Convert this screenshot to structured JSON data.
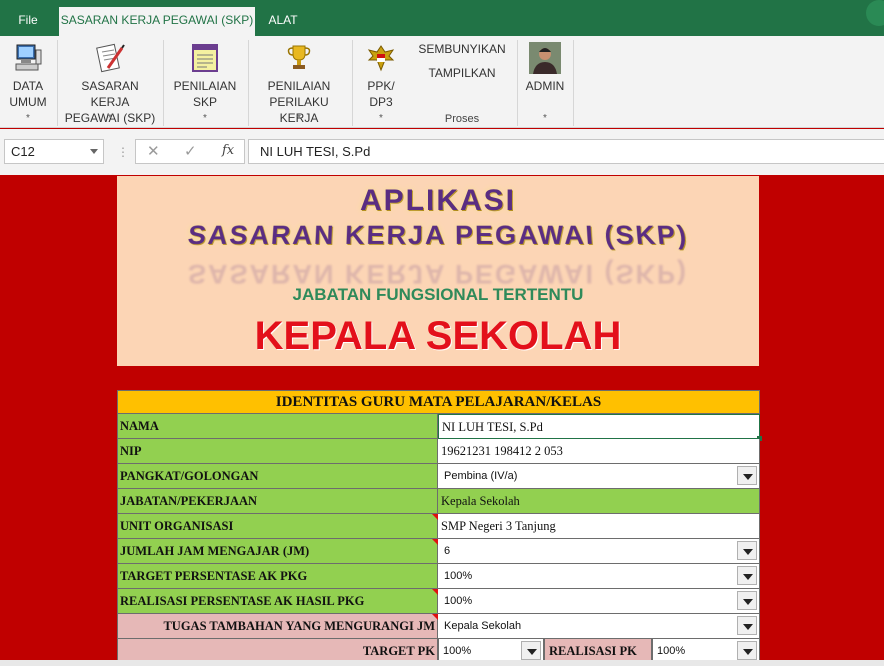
{
  "tabs": {
    "file": "File",
    "skp": "SASARAN KERJA PEGAWAI (SKP)",
    "alat": "ALAT"
  },
  "ribbon": {
    "groups": [
      {
        "label1": "DATA",
        "label2": "UMUM",
        "star": "*",
        "icon": "computer-icon"
      },
      {
        "label1": "SASARAN KERJA",
        "label2": "PEGAWAI (SKP)",
        "star": "*",
        "icon": "document-pen-icon"
      },
      {
        "label1": "PENILAIAN",
        "label2": "SKP",
        "star": "*",
        "icon": "notebook-icon"
      },
      {
        "label1": "PENILAIAN",
        "label2": "PERILAKU KERJA",
        "star": "*",
        "icon": "trophy-icon"
      },
      {
        "label1": "PPK/",
        "label2": "DP3",
        "star": "*",
        "icon": "garuda-icon"
      },
      {
        "label1": "ADMIN",
        "label2": "",
        "star": "*",
        "icon": "admin-photo-icon"
      }
    ],
    "proses": {
      "hide": "SEMBUNYIKAN",
      "show": "TAMPILKAN",
      "group_label": "Proses"
    }
  },
  "formula_bar": {
    "cell_ref": "C12",
    "dots": "⋮",
    "cancel": "✕",
    "enter": "✓",
    "fx": "fx",
    "content": "NI LUH TESI, S.Pd"
  },
  "banner": {
    "title1": "APLIKASI",
    "title2": "SASARAN KERJA PEGAWAI (SKP)",
    "subtitle": "JABATAN FUNGSIONAL TERTENTU",
    "main": "KEPALA SEKOLAH"
  },
  "identity": {
    "header": "IDENTITAS GURU MATA PELAJARAN/KELAS",
    "rows": [
      {
        "label": "NAMA",
        "value": "NI LUH TESI, S.Pd"
      },
      {
        "label": "NIP",
        "value": "19621231 198412 2 053"
      },
      {
        "label": "PANGKAT/GOLONGAN",
        "value": "Pembina (IV/a)"
      },
      {
        "label": "JABATAN/PEKERJAAN",
        "value": "Kepala Sekolah"
      },
      {
        "label": "UNIT ORGANISASI",
        "value": "SMP Negeri 3 Tanjung"
      },
      {
        "label": "JUMLAH JAM MENGAJAR (JM)",
        "value": "6"
      },
      {
        "label": "TARGET PERSENTASE AK PKG",
        "value": "100%"
      },
      {
        "label": "REALISASI PERSENTASE AK HASIL PKG",
        "value": "100%"
      },
      {
        "label": "TUGAS TAMBAHAN YANG MENGURANGI JM",
        "value": "Kepala Sekolah"
      }
    ],
    "last_row": {
      "target_label": "TARGET PK",
      "target_value": "100%",
      "realisasi_label": "REALISASI PK",
      "realisasi_value": "100%"
    }
  }
}
